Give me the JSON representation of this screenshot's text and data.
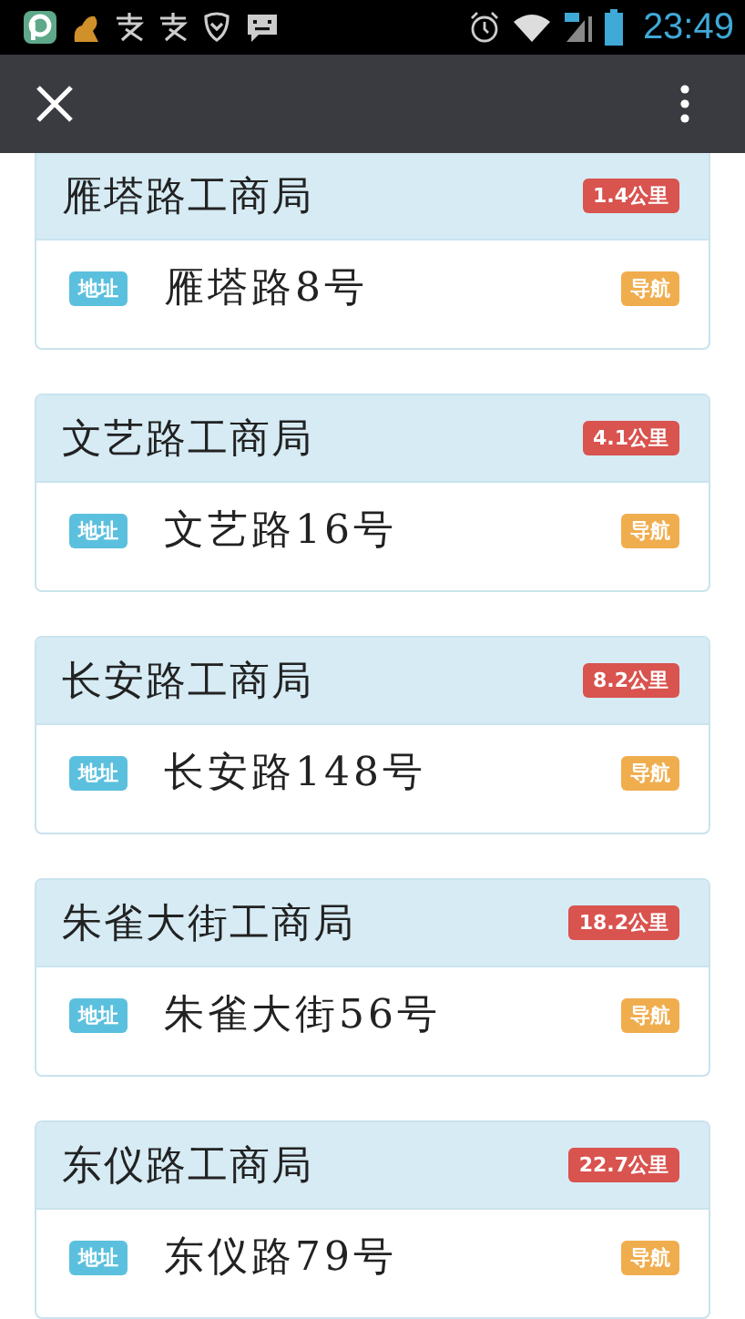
{
  "status_bar": {
    "time": "23:49"
  },
  "cards": [
    {
      "name": "雁塔路工商局",
      "distance": "1.4公里",
      "address_tag": "地址",
      "address": "雁塔路8号",
      "nav": "导航"
    },
    {
      "name": "文艺路工商局",
      "distance": "4.1公里",
      "address_tag": "地址",
      "address": "文艺路16号",
      "nav": "导航"
    },
    {
      "name": "长安路工商局",
      "distance": "8.2公里",
      "address_tag": "地址",
      "address": "长安路148号",
      "nav": "导航"
    },
    {
      "name": "朱雀大街工商局",
      "distance": "18.2公里",
      "address_tag": "地址",
      "address": "朱雀大街56号",
      "nav": "导航"
    },
    {
      "name": "东仪路工商局",
      "distance": "22.7公里",
      "address_tag": "地址",
      "address": "东仪路79号",
      "nav": "导航"
    }
  ]
}
